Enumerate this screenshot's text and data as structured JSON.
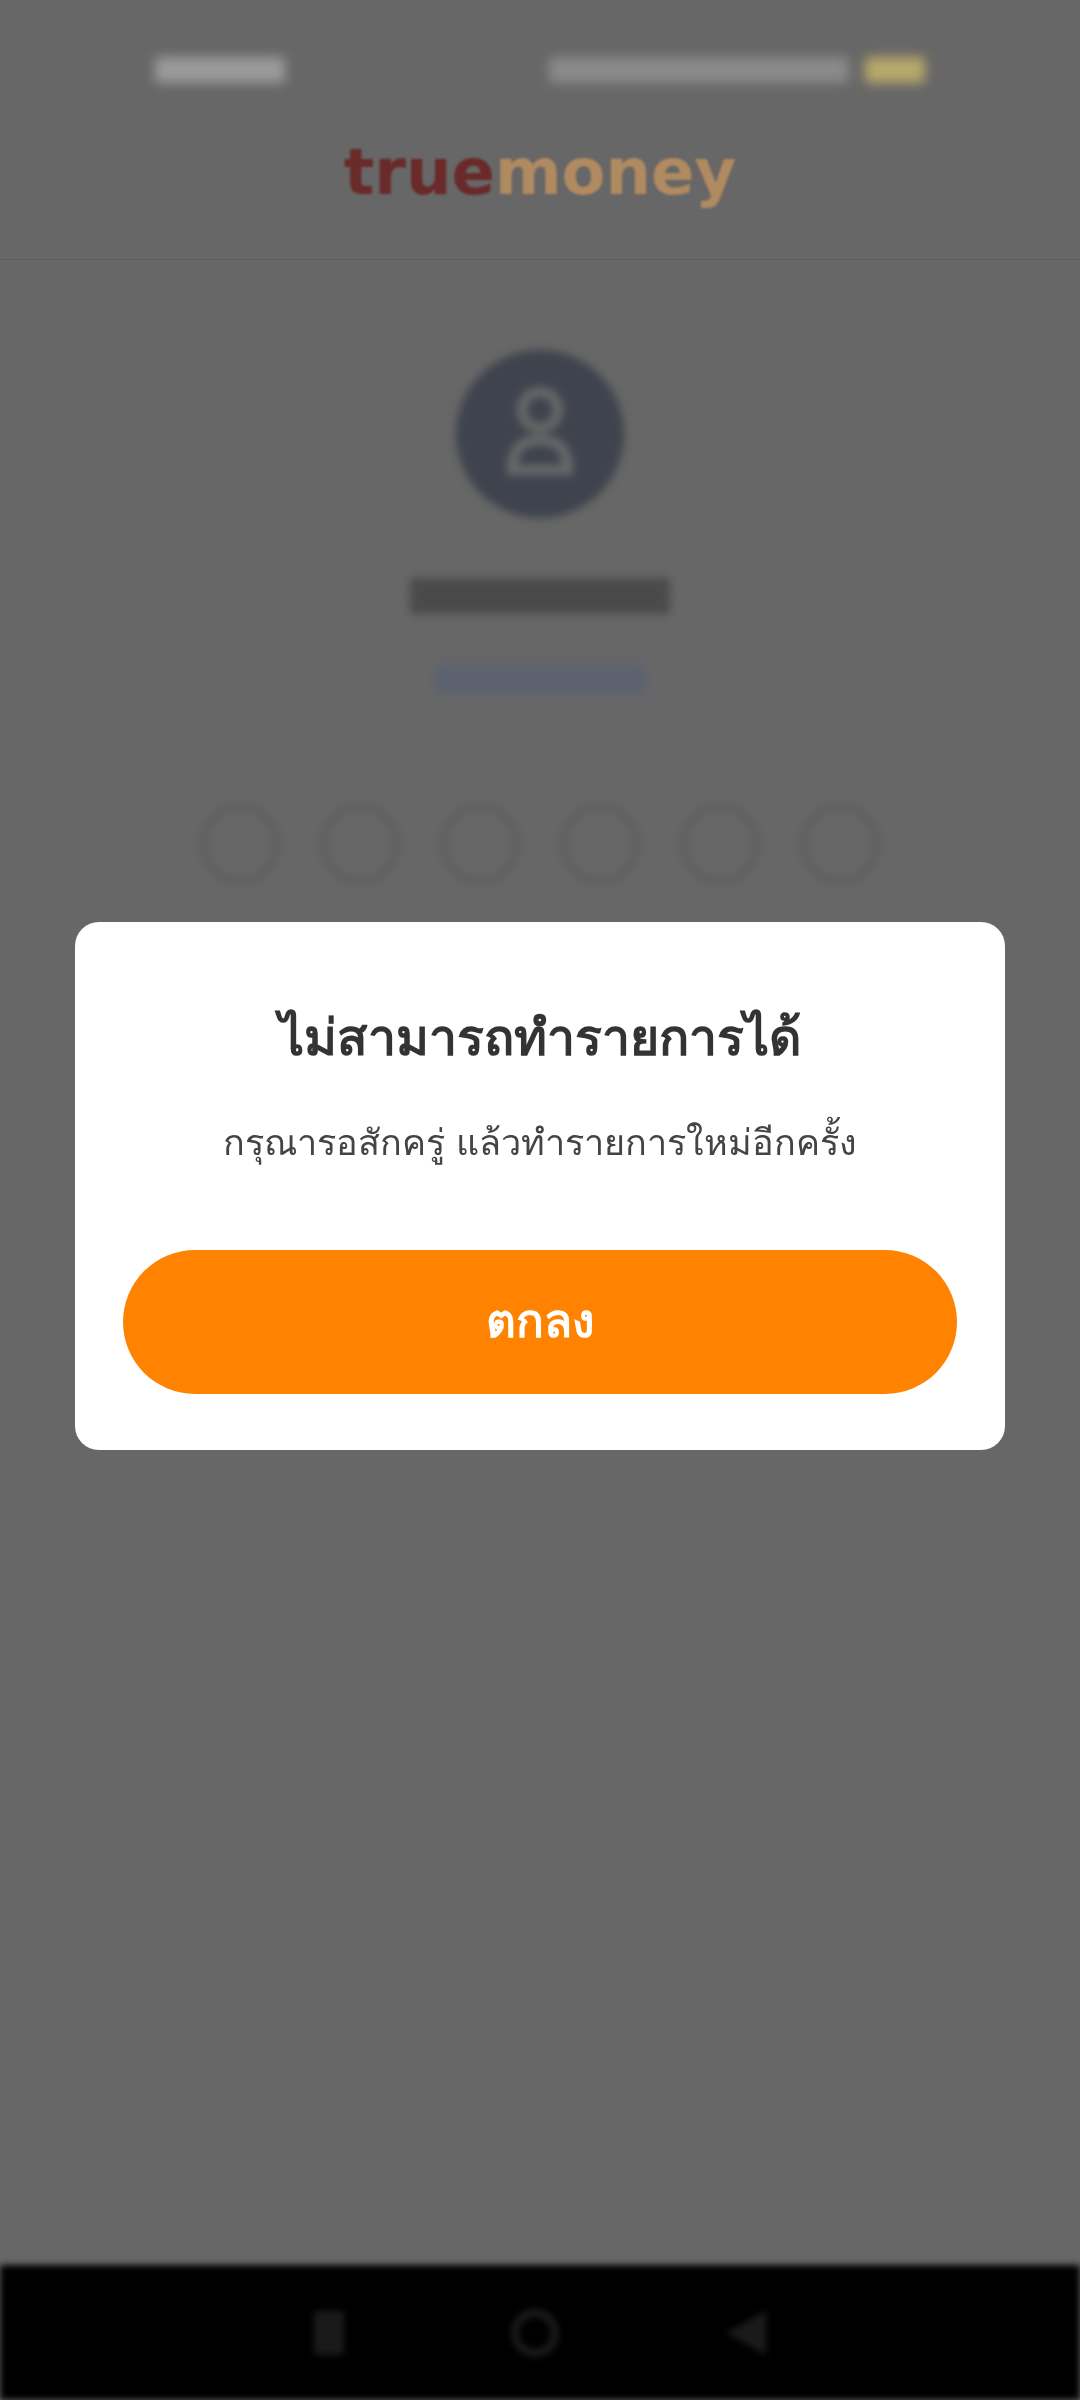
{
  "header": {
    "logo": [
      "true",
      "money"
    ]
  },
  "pin": {
    "dots": [
      {
        "filled": false
      },
      {
        "filled": false
      },
      {
        "filled": false
      },
      {
        "filled": false
      },
      {
        "filled": false
      },
      {
        "filled": false
      }
    ]
  },
  "dialog": {
    "title": "ไม่สามารถทำรายการได้",
    "message": "กรุณารอสักครู่ แล้วทำรายการใหม่อีกครั้ง",
    "button": "ตกลง"
  }
}
